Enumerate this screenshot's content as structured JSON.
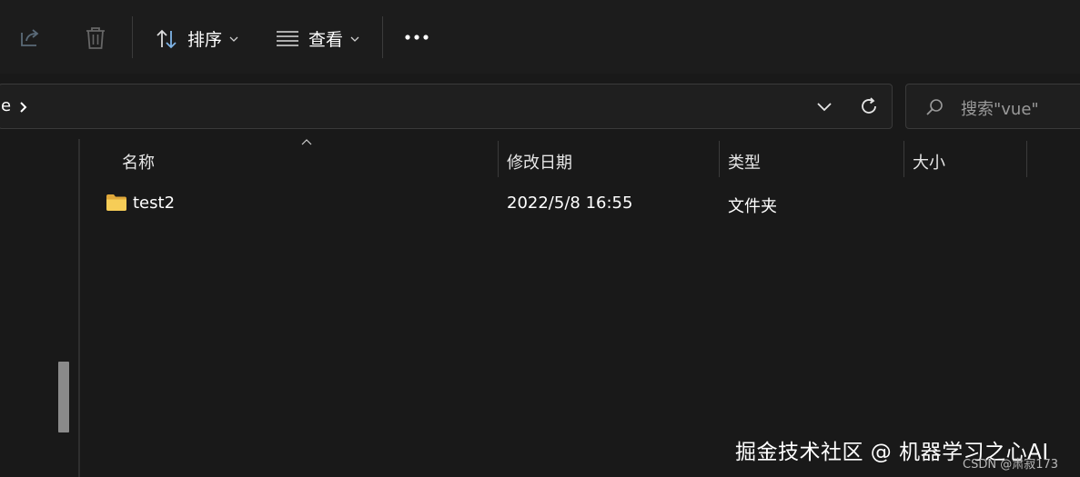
{
  "toolbar": {
    "share_icon": "share-icon",
    "delete_icon": "trash-icon",
    "sort": {
      "icon": "sort-arrows-icon",
      "label": "排序"
    },
    "view": {
      "icon": "view-list-icon",
      "label": "查看"
    },
    "more_icon": "more-horizontal-icon"
  },
  "address": {
    "crumb_text": "e",
    "crumb_chevron": "chevron-right-icon",
    "dropdown_icon": "chevron-down-icon",
    "refresh_icon": "refresh-icon"
  },
  "search": {
    "icon": "search-icon",
    "placeholder": "搜索\"vue\""
  },
  "columns": {
    "name": "名称",
    "modified": "修改日期",
    "type": "类型",
    "size": "大小"
  },
  "files": [
    {
      "icon": "folder-icon",
      "name": "test2",
      "modified": "2022/5/8 16:55",
      "type": "文件夹",
      "size": ""
    }
  ],
  "watermark": {
    "main": "掘金技术社区 @ 机器学习之心AI",
    "csdn": "CSDN @肃寂173"
  },
  "colors": {
    "background": "#191919",
    "toolbar": "#1c1c1c",
    "folder": "#f4c84a",
    "sort_accent": "#7fb4e6"
  }
}
